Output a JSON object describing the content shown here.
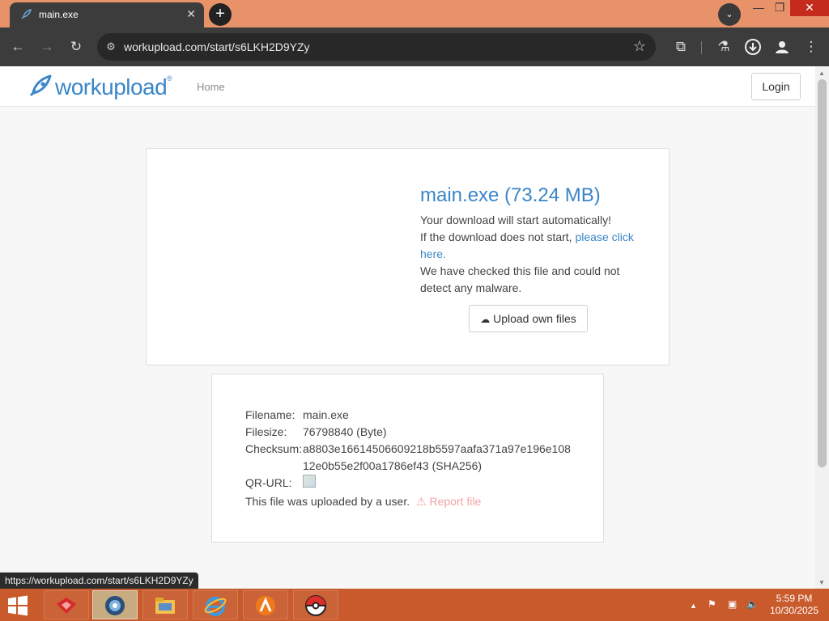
{
  "browser": {
    "tab_title": "main.exe",
    "tab_close": "✕",
    "new_tab": "+",
    "tab_search": "⌄",
    "url": "workupload.com/start/s6LKH2D9YZy",
    "window": {
      "minimize": "—",
      "restore": "❐",
      "close": "✕"
    }
  },
  "site": {
    "logo_text": "workupload",
    "logo_reg": "®",
    "nav_home": "Home",
    "login": "Login"
  },
  "download": {
    "title": "main.exe (73.24 MB)",
    "line1": "Your download will start automatically!",
    "line2_prefix": "If the download does not start, ",
    "line2_link": "please click here.",
    "line3": "We have checked this file and could not detect any malware.",
    "upload_button": "Upload own files"
  },
  "file_info": {
    "filename_label": "Filename:",
    "filename": "main.exe",
    "filesize_label": "Filesize:",
    "filesize": "76798840 (Byte)",
    "checksum_label": "Checksum:",
    "checksum_line1": "a8803e16614506609218b5597aafa371a97e196e108",
    "checksum_line2": "12e0b55e2f00a1786ef43 (SHA256)",
    "qr_label": "QR-URL:",
    "uploaded_by": "This file was uploaded by a user.",
    "report": "Report file"
  },
  "status_bar_url": "https://workupload.com/start/s6LKH2D9YZy",
  "taskbar": {
    "time": "5:59 PM",
    "date": "10/30/2025"
  },
  "icons": [
    "rocket-icon",
    "close-icon",
    "plus-icon",
    "chevron-down-icon",
    "back-icon",
    "forward-icon",
    "reload-icon",
    "site-info-icon",
    "star-icon",
    "extensions-icon",
    "labs-icon",
    "download-icon",
    "profile-icon",
    "menu-icon",
    "cloud-upload-icon",
    "warning-icon",
    "windows-start-icon",
    "folder-icon",
    "ie-icon",
    "pokeball-icon"
  ],
  "colors": {
    "accent": "#3a86c8",
    "report": "#f2a3a3",
    "tabstrip": "#e8926a",
    "taskbar": "#c85a2c"
  }
}
